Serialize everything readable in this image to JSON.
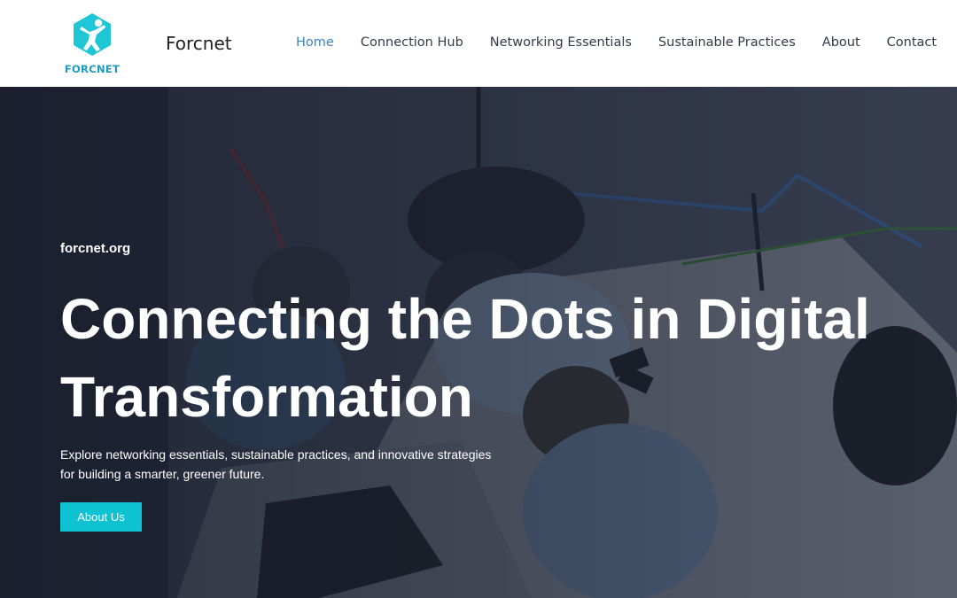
{
  "brand": {
    "logo_text": "FORCNET",
    "site_name": "Forcnet",
    "logo_color": "#1fc7d6",
    "logo_text_color": "#1a9bbf"
  },
  "nav": {
    "items": [
      {
        "label": "Home",
        "active": true
      },
      {
        "label": "Connection Hub",
        "active": false
      },
      {
        "label": "Networking Essentials",
        "active": false
      },
      {
        "label": "Sustainable Practices",
        "active": false
      },
      {
        "label": "About",
        "active": false
      },
      {
        "label": "Contact",
        "active": false
      }
    ],
    "active_color": "#3b82c4"
  },
  "hero": {
    "eyebrow": "forcnet.org",
    "headline": "Connecting the Dots in Digital Transformation",
    "lead": "Explore networking essentials, sustainable practices, and innovative strategies for building a smarter, greener future.",
    "cta_label": "About Us",
    "cta_color": "#0fc2d2"
  }
}
